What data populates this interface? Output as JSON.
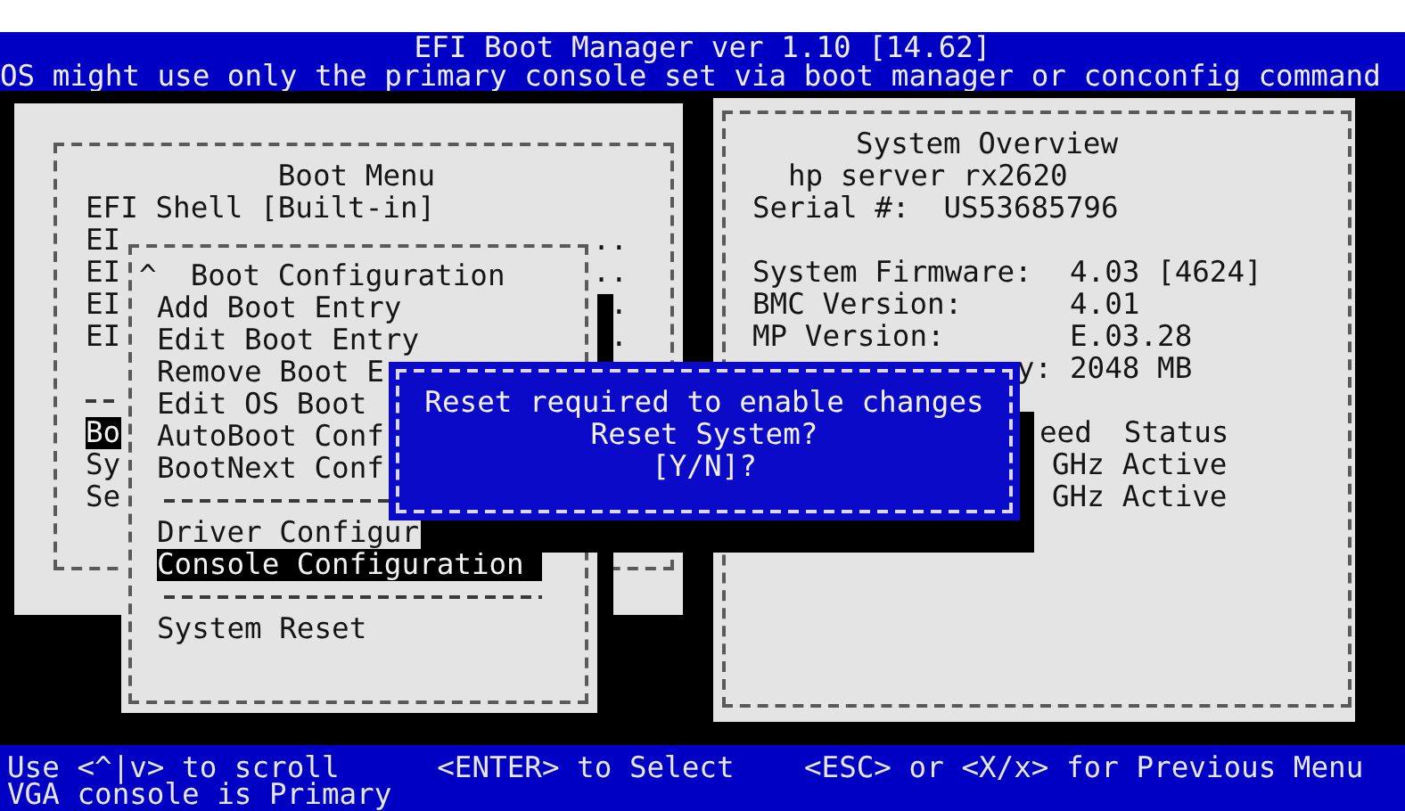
{
  "header": {
    "title": "EFI Boot Manager ver 1.10 [14.62]",
    "notice": "OS might use only the primary console set via boot manager or conconfig command"
  },
  "boot_menu": {
    "title": "Boot Menu",
    "items": [
      {
        "kind": "entry",
        "text": "EFI Shell [Built-in]",
        "selected": false
      },
      {
        "kind": "entry",
        "text": "EI",
        "trail": "..",
        "selected": false
      },
      {
        "kind": "entry",
        "text": "EI",
        "trail": "..",
        "selected": false
      },
      {
        "kind": "entry",
        "text": "EI",
        "trail": ".",
        "selected": false
      },
      {
        "kind": "entry",
        "text": "EI",
        "trail": ".",
        "selected": false
      },
      {
        "kind": "separator"
      },
      {
        "kind": "entry",
        "text": "Bo",
        "selected": true
      },
      {
        "kind": "entry",
        "text": "Sy",
        "selected": false
      },
      {
        "kind": "entry",
        "text": "Se",
        "selected": false
      }
    ]
  },
  "submenu": {
    "scroll_indicator": "^",
    "title": "Boot Configuration",
    "items": [
      {
        "kind": "entry",
        "text": "Add Boot Entry",
        "selected": false
      },
      {
        "kind": "entry",
        "text": "Edit Boot Entry",
        "selected": false
      },
      {
        "kind": "entry",
        "text": "Remove Boot E",
        "selected": false
      },
      {
        "kind": "entry",
        "text": "Edit OS Boot",
        "selected": false
      },
      {
        "kind": "entry",
        "text": "AutoBoot Conf",
        "selected": false
      },
      {
        "kind": "entry",
        "text": "BootNext Conf",
        "selected": false
      },
      {
        "kind": "separator"
      },
      {
        "kind": "entry",
        "text": "Driver Configur",
        "selected": false
      },
      {
        "kind": "entry",
        "text": "Console Configuration",
        "selected": true
      },
      {
        "kind": "separator"
      },
      {
        "kind": "entry",
        "text": "System Reset",
        "selected": false
      }
    ]
  },
  "overview": {
    "title": "System Overview",
    "model": "hp server rx2620",
    "serial": {
      "label": "Serial #:",
      "value": "US53685796"
    },
    "fields": [
      {
        "kind": "full",
        "label": "System Firmware:",
        "value": "4.03 [4624]"
      },
      {
        "kind": "full",
        "label": "BMC Version:",
        "value": "4.01"
      },
      {
        "kind": "full",
        "label": "MP Version:",
        "value": "E.03.28"
      },
      {
        "kind": "cut",
        "label": "y:",
        "value": "2048 MB"
      }
    ],
    "cpu_table": {
      "columns": [
        "eed",
        "Status"
      ],
      "rows": [
        [
          "GHz",
          "Active"
        ],
        [
          "GHz",
          "Active"
        ]
      ]
    }
  },
  "dialog": {
    "lines": [
      "Reset required to enable changes",
      "Reset System?",
      "[Y/N]?"
    ]
  },
  "status_bar": {
    "hints": [
      "Use <^|v> to scroll",
      "<ENTER> to Select",
      "<ESC> or <X/x> for Previous Menu"
    ],
    "message": "VGA console is Primary"
  }
}
